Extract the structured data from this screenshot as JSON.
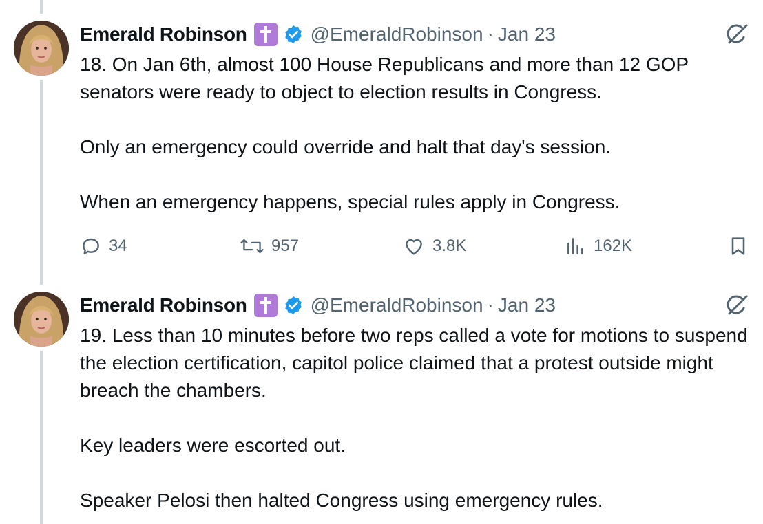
{
  "tweets": [
    {
      "author_name": "Emerald Robinson",
      "handle": "@EmeraldRobinson",
      "separator": "·",
      "date": "Jan 23",
      "text": "18. On Jan 6th, almost 100 House Republicans and more than 12 GOP senators were ready to object to election results in Congress.\n\nOnly an emergency could override and halt that day's session.\n\nWhen an emergency happens, special rules apply in Congress.",
      "replies": "34",
      "reposts": "957",
      "likes": "3.8K",
      "views": "162K"
    },
    {
      "author_name": "Emerald Robinson",
      "handle": "@EmeraldRobinson",
      "separator": "·",
      "date": "Jan 23",
      "text": "19. Less than 10 minutes before two reps called a vote for motions to suspend the election certification, capitol police claimed that a protest outside might breach the chambers.\n\nKey leaders were escorted out.\n\nSpeaker Pelosi then halted Congress using emergency rules."
    }
  ],
  "icons": {
    "badge": "latin-cross-icon",
    "verified": "verified-badge-icon",
    "grok": "grok-icon",
    "reply": "reply-icon",
    "repost": "repost-icon",
    "like": "heart-icon",
    "views": "views-icon",
    "bookmark": "bookmark-icon"
  },
  "colors": {
    "verified": "#1d9bf0",
    "cross_badge": "#b07bd8",
    "secondary_text": "#536471",
    "thread_line": "#cfd9de"
  }
}
